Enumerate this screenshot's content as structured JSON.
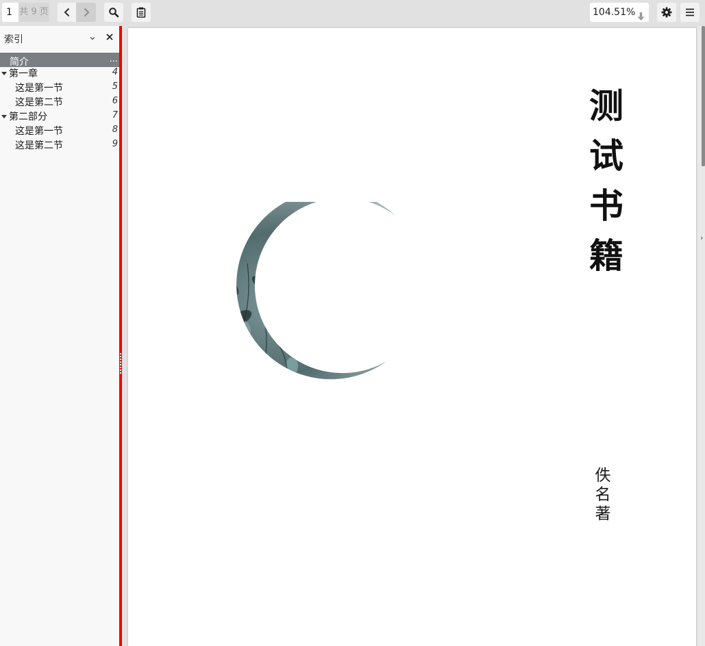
{
  "toolbar": {
    "page_number": "1",
    "page_total": "共 9 页",
    "zoom": "104.51%",
    "icons": {
      "prev": "chevron-left-icon",
      "next": "chevron-right-icon",
      "search": "search-icon",
      "notes": "clipboard-icon",
      "zoom_dropdown": "arrow-down-icon",
      "settings": "gear-icon",
      "menu": "hamburger-menu-icon"
    }
  },
  "sidebar": {
    "title": "索引",
    "toc": [
      {
        "label": "简介",
        "page": "...",
        "level": 0,
        "active": true,
        "expandable": false
      },
      {
        "label": "第一章",
        "page": "4",
        "level": 0,
        "active": false,
        "expandable": true
      },
      {
        "label": "这是第一节",
        "page": "5",
        "level": 1,
        "active": false,
        "expandable": false
      },
      {
        "label": "这是第二节",
        "page": "6",
        "level": 1,
        "active": false,
        "expandable": false
      },
      {
        "label": "第二部分",
        "page": "7",
        "level": 0,
        "active": false,
        "expandable": true
      },
      {
        "label": "这是第一节",
        "page": "8",
        "level": 1,
        "active": false,
        "expandable": false
      },
      {
        "label": "这是第二节",
        "page": "9",
        "level": 1,
        "active": false,
        "expandable": false
      }
    ]
  },
  "document": {
    "cover_title_chars": [
      "测",
      "试",
      "书",
      "籍"
    ],
    "cover_author_chars": [
      "佚",
      "名",
      "著"
    ]
  },
  "colors": {
    "divider": "#ee0000",
    "toc_active_bg": "#7b7e82",
    "toolbar_bg": "#e1e1e1",
    "sidebar_bg": "#f8f8f8"
  }
}
